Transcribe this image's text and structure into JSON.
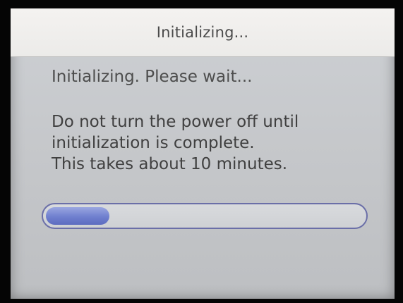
{
  "dialog": {
    "title": "Initializing...",
    "status": "Initializing. Please wait...",
    "warning_lines": [
      "Do not turn the power off until",
      "initialization is complete.",
      "This takes about 10 minutes."
    ]
  },
  "progress": {
    "fraction": 0.2
  }
}
